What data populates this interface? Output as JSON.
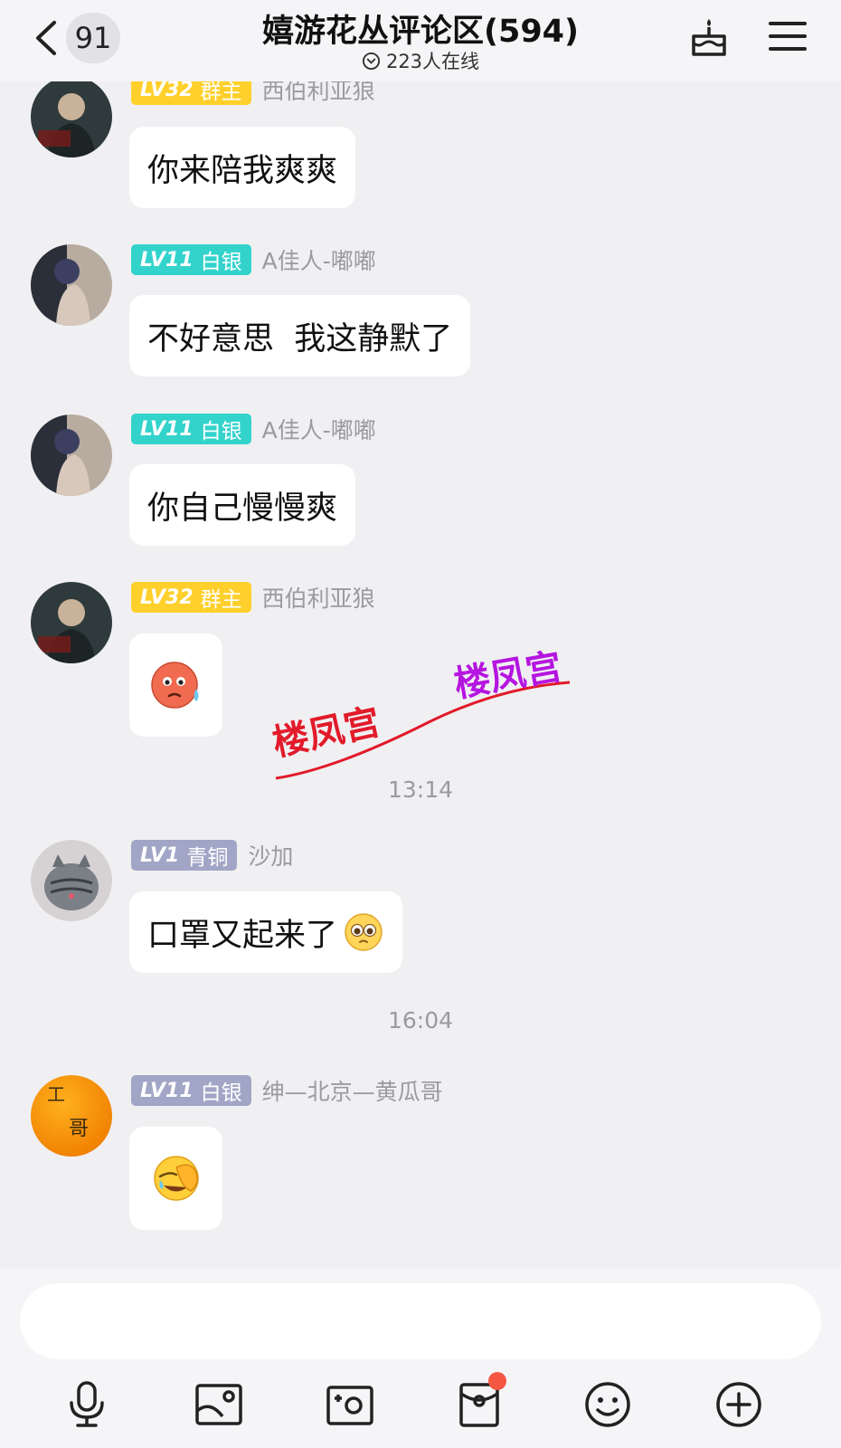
{
  "header": {
    "unread_count": "91",
    "title": "嬉游花丛评论区(594)",
    "online_text": "223人在线"
  },
  "messages": [
    {
      "level": "LV32",
      "level_title": "群主",
      "level_style": "gold",
      "sender": "西伯利亚狼",
      "text": "你来陪我爽爽"
    },
    {
      "level": "LV11",
      "level_title": "白银",
      "level_style": "teal",
      "sender": "A佳人-嘟嘟",
      "text": "不好意思  我这静默了"
    },
    {
      "level": "LV11",
      "level_title": "白银",
      "level_style": "teal",
      "sender": "A佳人-嘟嘟",
      "text": "你自己慢慢爽"
    },
    {
      "level": "LV32",
      "level_title": "群主",
      "level_style": "gold",
      "sender": "西伯利亚狼",
      "sticker": "sweat-emoji"
    },
    {
      "level": "LV1",
      "level_title": "青铜",
      "level_style": "silver",
      "sender": "沙加",
      "text": "口罩又起来了",
      "inline_emoji": "pleading-emoji"
    },
    {
      "level": "LV11",
      "level_title": "白银",
      "level_style": "silver",
      "sender": "绅—北京—黄瓜哥",
      "sticker": "facepalm-emoji"
    }
  ],
  "timestamps": [
    "13:14",
    "16:04"
  ],
  "watermark": {
    "text_1": "楼凤宫",
    "text_2": "楼凤宫"
  },
  "avatar_text": {
    "orange_1": "工",
    "orange_2": "哥"
  },
  "input": {
    "placeholder": ""
  },
  "toolbar": [
    "microphone-icon",
    "image-icon",
    "camera-icon",
    "red-packet-icon",
    "emoji-icon",
    "plus-icon"
  ],
  "colors": {
    "gold": "#ffd02c",
    "teal": "#33d3cc",
    "silver": "#a1a6c6",
    "notification": "#f45742"
  }
}
